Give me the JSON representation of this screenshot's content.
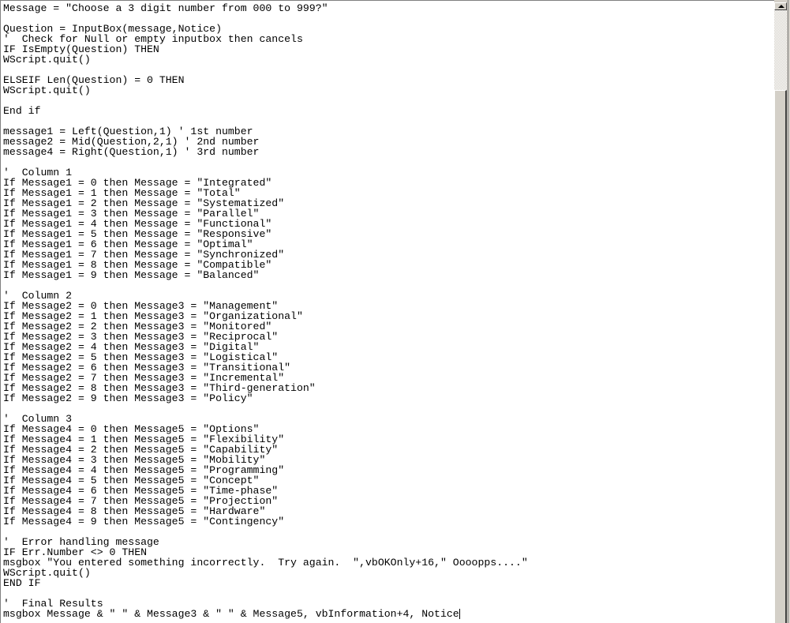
{
  "editor": {
    "lines": [
      "Message = \"Choose a 3 digit number from 000 to 999?\"",
      "",
      "Question = InputBox(message,Notice)",
      "'  Check for Null or empty inputbox then cancels",
      "IF IsEmpty(Question) THEN",
      "WScript.quit()",
      "",
      "ELSEIF Len(Question) = 0 THEN",
      "WScript.quit()",
      "",
      "End if",
      "",
      "message1 = Left(Question,1) ' 1st number",
      "message2 = Mid(Question,2,1) ' 2nd number",
      "message4 = Right(Question,1) ' 3rd number",
      "",
      "'  Column 1",
      "If Message1 = 0 then Message = \"Integrated\"",
      "If Message1 = 1 then Message = \"Total\"",
      "If Message1 = 2 then Message = \"Systematized\"",
      "If Message1 = 3 then Message = \"Parallel\"",
      "If Message1 = 4 then Message = \"Functional\"",
      "If Message1 = 5 then Message = \"Responsive\"",
      "If Message1 = 6 then Message = \"Optimal\"",
      "If Message1 = 7 then Message = \"Synchronized\"",
      "If Message1 = 8 then Message = \"Compatible\"",
      "If Message1 = 9 then Message = \"Balanced\"",
      "",
      "'  Column 2",
      "If Message2 = 0 then Message3 = \"Management\"",
      "If Message2 = 1 then Message3 = \"Organizational\"",
      "If Message2 = 2 then Message3 = \"Monitored\"",
      "If Message2 = 3 then Message3 = \"Reciprocal\"",
      "If Message2 = 4 then Message3 = \"Digital\"",
      "If Message2 = 5 then Message3 = \"Logistical\"",
      "If Message2 = 6 then Message3 = \"Transitional\"",
      "If Message2 = 7 then Message3 = \"Incremental\"",
      "If Message2 = 8 then Message3 = \"Third-generation\"",
      "If Message2 = 9 then Message3 = \"Policy\"",
      "",
      "'  Column 3",
      "If Message4 = 0 then Message5 = \"Options\"",
      "If Message4 = 1 then Message5 = \"Flexibility\"",
      "If Message4 = 2 then Message5 = \"Capability\"",
      "If Message4 = 3 then Message5 = \"Mobility\"",
      "If Message4 = 4 then Message5 = \"Programming\"",
      "If Message4 = 5 then Message5 = \"Concept\"",
      "If Message4 = 6 then Message5 = \"Time-phase\"",
      "If Message4 = 7 then Message5 = \"Projection\"",
      "If Message4 = 8 then Message5 = \"Hardware\"",
      "If Message4 = 9 then Message5 = \"Contingency\"",
      "",
      "'  Error handling message",
      "IF Err.Number <> 0 THEN",
      "msgbox \"You entered something incorrectly.  Try again.  \",vbOKOnly+16,\" Oooopps....\"",
      "WScript.quit()",
      "END IF",
      "",
      "'  Final Results",
      "msgbox Message & \" \" & Message3 & \" \" & Message5, vbInformation+4, Notice"
    ]
  },
  "scrollbar": {
    "position_fraction": 0.13,
    "up_arrow_icon": "arrow-up-icon"
  }
}
